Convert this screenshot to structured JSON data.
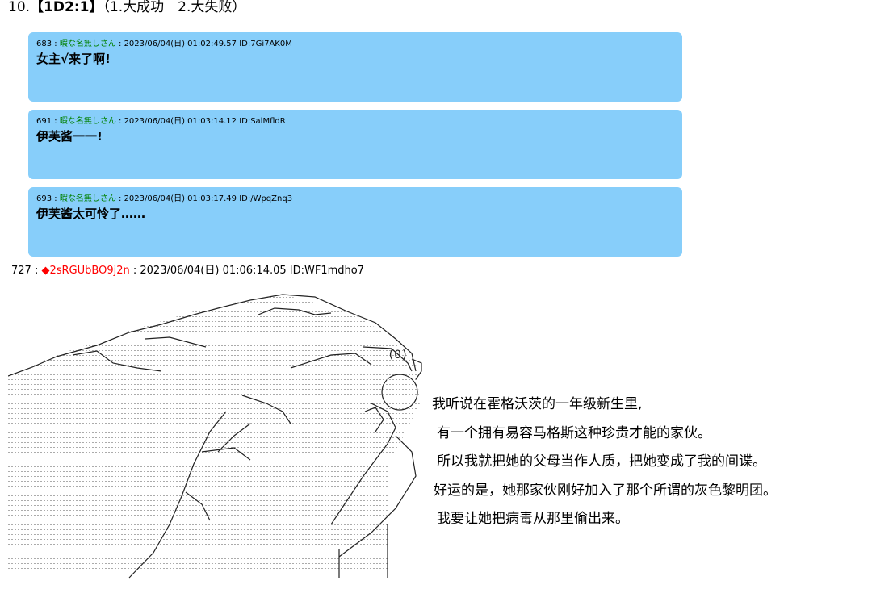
{
  "heading": {
    "number": "10.",
    "dice": "【1D2:1】",
    "options": "（1.大成功　2.大失败）"
  },
  "quoted_posts": [
    {
      "num": "683",
      "name": "暇な名無しさん",
      "date": "2023/06/04(日) 01:02:49.57",
      "id": "ID:7Gi7AK0M",
      "body": "女主√来了啊!"
    },
    {
      "num": "691",
      "name": "暇な名無しさん",
      "date": "2023/06/04(日) 01:03:14.12",
      "id": "ID:SalMfldR",
      "body": "伊芙酱一一!"
    },
    {
      "num": "693",
      "name": "暇な名無しさん",
      "date": "2023/06/04(日) 01:03:17.49",
      "id": "ID:/WpqZnq3",
      "body": "伊芙酱太可怜了……"
    }
  ],
  "main_post": {
    "num": "727",
    "trip": "◆2sRGUbBO9j2n",
    "date": "2023/06/04(日) 01:06:14.05",
    "id": "ID:WF1mdho7"
  },
  "story_lines": [
    "我听说在霍格沃茨的一年级新生里,",
    "有一个拥有易容马格斯这种珍贵才能的家伙。",
    "所以我就把她的父母当作人质，把她变成了我的间谍。",
    "好运的是，她那家伙刚好加入了那个所谓的灰色黎明团。",
    "我要让她把病毒从那里偷出来。"
  ],
  "colors": {
    "post_bg": "#87cefa",
    "name_green": "#008000",
    "trip_red": "#ff0000"
  }
}
